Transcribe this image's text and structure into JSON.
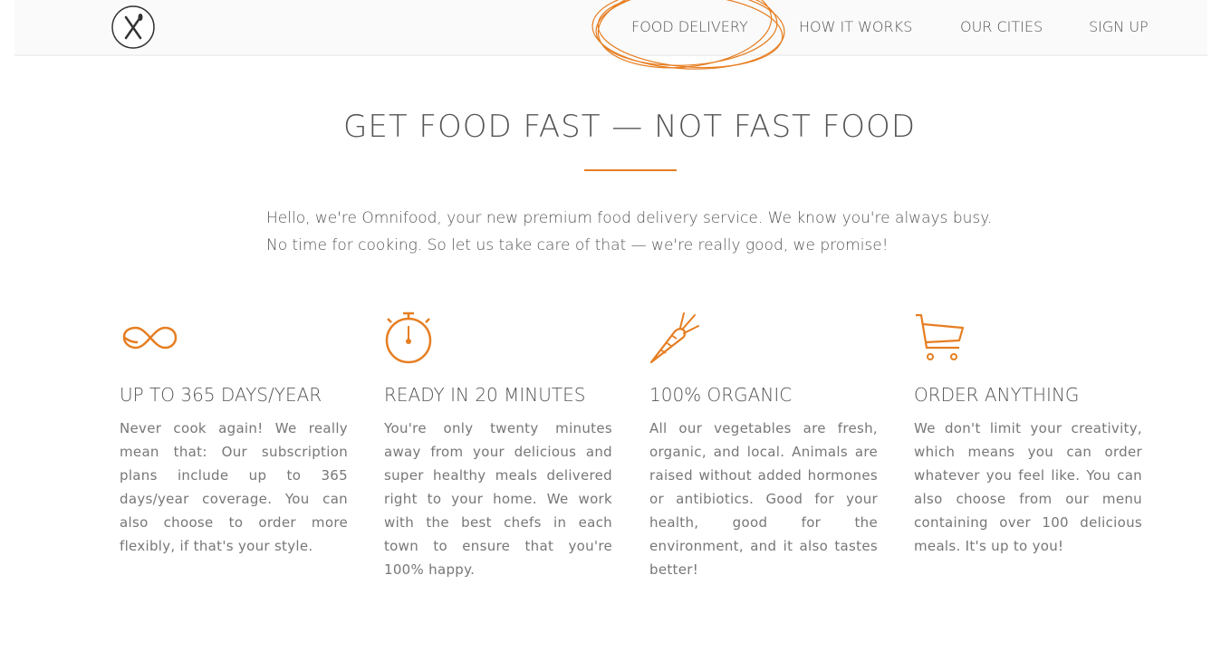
{
  "nav": {
    "logo_alt": "Omnifood logo",
    "items": [
      "FOOD DELIVERY",
      "HOW IT WORKS",
      "OUR CITIES",
      "SIGN UP"
    ]
  },
  "hero": {
    "title": "GET FOOD FAST — NOT FAST FOOD",
    "intro_line1": "Hello, we're Omnifood, your new premium food delivery service. We know you're always busy.",
    "intro_line2": "No time for cooking. So let us take care of that — we're really good, we promise!"
  },
  "features": [
    {
      "icon": "infinity-icon",
      "title": "UP TO 365 DAYS/YEAR",
      "text": "Never cook again! We really mean that: Our subscription plans include up to 365 days/year coverage. You can also choose to order more flexibly, if that's your style."
    },
    {
      "icon": "stopwatch-icon",
      "title": "READY IN 20 MINUTES",
      "text": "You're only twenty minutes away from your delicious and super healthy meals delivered right to your home. We work with the best chefs in each town to ensure that you're 100% happy."
    },
    {
      "icon": "carrot-icon",
      "title": "100% ORGANIC",
      "text": "All our vegetables are fresh, organic, and local. Animals are raised without added hormones or antibiotics. Good for your health, good for the environment, and it also tastes better!"
    },
    {
      "icon": "cart-icon",
      "title": "ORDER ANYTHING",
      "text": "We don't limit your creativity, which means you can order whatever you feel like. You can also choose from our menu containing over 100 delicious meals. It's up to you!"
    }
  ],
  "colors": {
    "accent": "#e67e22",
    "text": "#555555"
  }
}
